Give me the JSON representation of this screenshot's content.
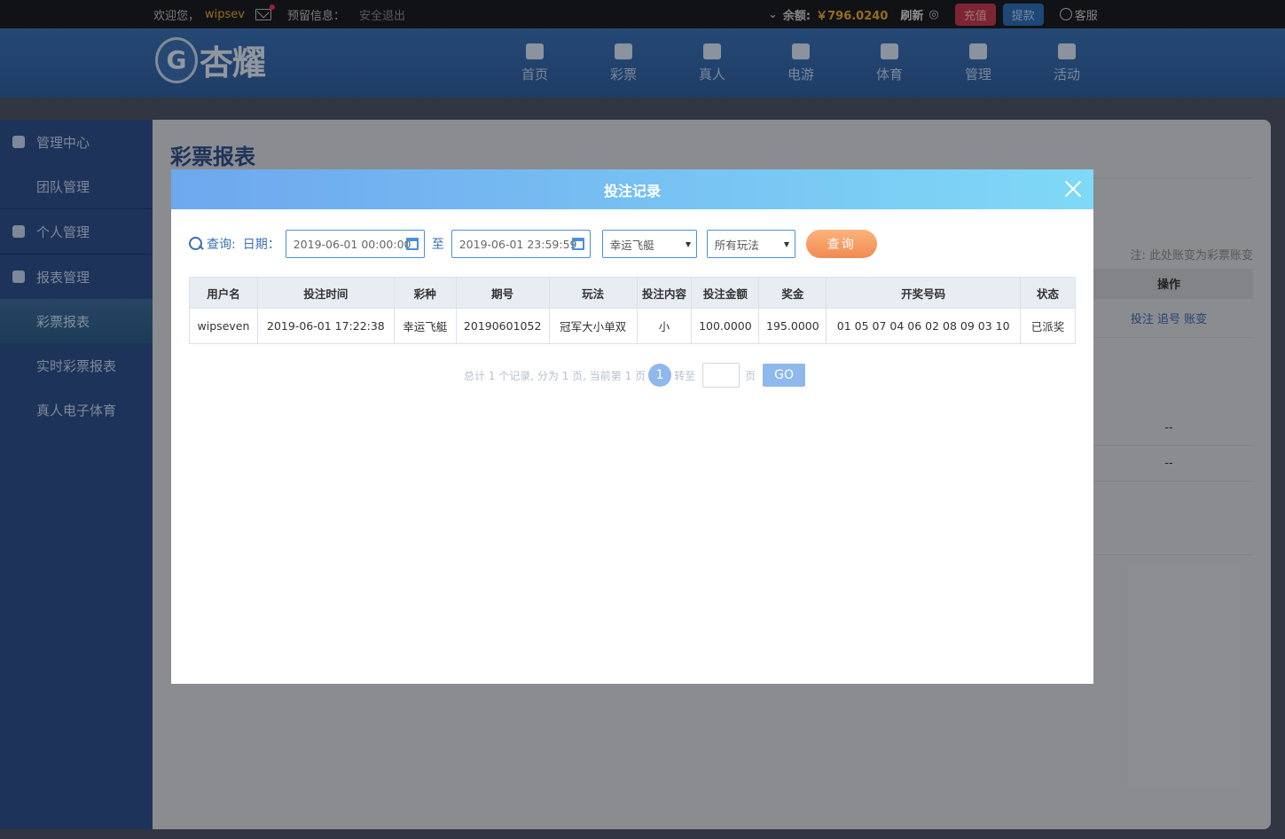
{
  "topbar": {
    "welcome": "欢迎您，",
    "username": "wipsev",
    "reserved": "预留信息：",
    "logout": "安全退出",
    "balance_label": "余额:",
    "balance": "￥796.0240",
    "refresh": "刷新",
    "deposit": "充值",
    "withdraw": "提款",
    "service": "客服"
  },
  "header": {
    "logo_text": "杏耀",
    "nav": [
      "首页",
      "彩票",
      "真人",
      "电游",
      "体育",
      "管理",
      "活动"
    ]
  },
  "sidebar": {
    "items": [
      {
        "label": "管理中心"
      },
      {
        "label": "团队管理"
      },
      {
        "label": "个人管理"
      },
      {
        "label": "报表管理"
      },
      {
        "label": "彩票报表"
      },
      {
        "label": "实时彩票报表"
      },
      {
        "label": "真人电子体育"
      }
    ]
  },
  "main": {
    "title": "彩票报表",
    "note": "注: 此处账变为彩票账变",
    "col_ops": "操作",
    "ops": "投注 追号 账变",
    "dash": "--"
  },
  "modal": {
    "title": "投注记录",
    "search_label": "查询:",
    "date_label": "日期：",
    "date_from": "2019-06-01 00:00:00",
    "to": "至",
    "date_to": "2019-06-01 23:59:59",
    "lottery": "幸运飞艇",
    "play": "所有玩法",
    "query": "查询",
    "columns": [
      "用户名",
      "投注时间",
      "彩种",
      "期号",
      "玩法",
      "投注内容",
      "投注金额",
      "奖金",
      "开奖号码",
      "状态"
    ],
    "rows": [
      [
        "wipseven",
        "2019-06-01 17:22:38",
        "幸运飞艇",
        "20190601052",
        "冠军大小单双",
        "小",
        "100.0000",
        "195.0000",
        "01 05 07 04 06 02 08 09 03 10",
        "已派奖"
      ]
    ],
    "pager_text": "总计 1 个记录, 分为 1 页, 当前第 1 页",
    "current_page": "1",
    "goto": "转至",
    "page_unit": "页",
    "go": "GO"
  }
}
